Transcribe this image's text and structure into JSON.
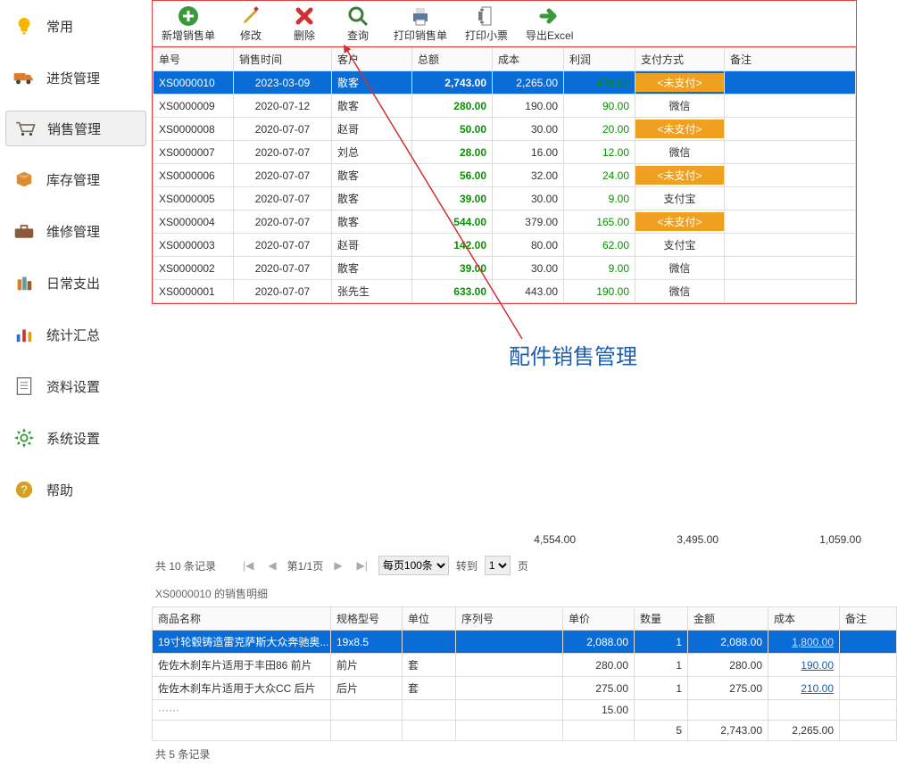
{
  "sidebar": {
    "items": [
      {
        "label": "常用",
        "icon": "bulb",
        "color": "#f7b500"
      },
      {
        "label": "进货管理",
        "icon": "truck",
        "color": "#d97c2b"
      },
      {
        "label": "销售管理",
        "icon": "cart",
        "color": "#7a6a4f",
        "active": true
      },
      {
        "label": "库存管理",
        "icon": "box",
        "color": "#e08b2c"
      },
      {
        "label": "维修管理",
        "icon": "toolbox",
        "color": "#8a5a3a"
      },
      {
        "label": "日常支出",
        "icon": "bottles",
        "color": "#5aa0a0"
      },
      {
        "label": "统计汇总",
        "icon": "chart",
        "color": "#2c6cd6"
      },
      {
        "label": "资料设置",
        "icon": "doc",
        "color": "#6a6a6a"
      },
      {
        "label": "系统设置",
        "icon": "gear",
        "color": "#3a9a3a"
      },
      {
        "label": "帮助",
        "icon": "coin",
        "color": "#d6a020"
      }
    ]
  },
  "toolbar": [
    {
      "label": "新增销售单",
      "icon": "add",
      "color": "#3a9a3a"
    },
    {
      "label": "修改",
      "icon": "edit",
      "color": "#d6a020"
    },
    {
      "label": "删除",
      "icon": "delete",
      "color": "#d03030"
    },
    {
      "label": "查询",
      "icon": "search",
      "color": "#3a7a3a"
    },
    {
      "label": "打印销售单",
      "icon": "printer",
      "color": "#5a7aa0"
    },
    {
      "label": "打印小票",
      "icon": "receipt",
      "color": "#7a7a7a"
    },
    {
      "label": "导出Excel",
      "icon": "export",
      "color": "#3a9a3a"
    }
  ],
  "sales": {
    "headers": [
      "单号",
      "销售时间",
      "客户",
      "总额",
      "成本",
      "利润",
      "支付方式",
      "备注"
    ],
    "rows": [
      {
        "no": "XS0000010",
        "date": "2023-03-09",
        "cust": "散客",
        "total": "2,743.00",
        "cost": "2,265.00",
        "profit": "478.00",
        "pay": "<未支付>",
        "badge": true,
        "selected": true
      },
      {
        "no": "XS0000009",
        "date": "2020-07-12",
        "cust": "散客",
        "total": "280.00",
        "cost": "190.00",
        "profit": "90.00",
        "pay": "微信"
      },
      {
        "no": "XS0000008",
        "date": "2020-07-07",
        "cust": "赵哥",
        "total": "50.00",
        "cost": "30.00",
        "profit": "20.00",
        "pay": "<未支付>",
        "badge": true
      },
      {
        "no": "XS0000007",
        "date": "2020-07-07",
        "cust": "刘总",
        "total": "28.00",
        "cost": "16.00",
        "profit": "12.00",
        "pay": "微信"
      },
      {
        "no": "XS0000006",
        "date": "2020-07-07",
        "cust": "散客",
        "total": "56.00",
        "cost": "32.00",
        "profit": "24.00",
        "pay": "<未支付>",
        "badge": true
      },
      {
        "no": "XS0000005",
        "date": "2020-07-07",
        "cust": "散客",
        "total": "39.00",
        "cost": "30.00",
        "profit": "9.00",
        "pay": "支付宝"
      },
      {
        "no": "XS0000004",
        "date": "2020-07-07",
        "cust": "散客",
        "total": "544.00",
        "cost": "379.00",
        "profit": "165.00",
        "pay": "<未支付>",
        "badge": true
      },
      {
        "no": "XS0000003",
        "date": "2020-07-07",
        "cust": "赵哥",
        "total": "142.00",
        "cost": "80.00",
        "profit": "62.00",
        "pay": "支付宝"
      },
      {
        "no": "XS0000002",
        "date": "2020-07-07",
        "cust": "散客",
        "total": "39.00",
        "cost": "30.00",
        "profit": "9.00",
        "pay": "微信"
      },
      {
        "no": "XS0000001",
        "date": "2020-07-07",
        "cust": "张先生",
        "total": "633.00",
        "cost": "443.00",
        "profit": "190.00",
        "pay": "微信"
      }
    ],
    "totals": {
      "total": "4,554.00",
      "cost": "3,495.00",
      "profit": "1,059.00"
    }
  },
  "annotation": "配件销售管理",
  "pager": {
    "count_text": "共 10 条记录",
    "page_text": "第1/1页",
    "per_page": "每页100条",
    "jump_label": "转到",
    "jump_value": "1",
    "jump_suffix": "页"
  },
  "detail": {
    "title": "XS0000010 的销售明细",
    "headers": [
      "商品名称",
      "规格型号",
      "单位",
      "序列号",
      "单价",
      "数量",
      "金额",
      "成本",
      "备注"
    ],
    "rows": [
      {
        "name": "19寸轮毂铸造雷克萨斯大众奔驰奥...",
        "spec": "19x8.5",
        "unit": "",
        "serial": "",
        "price": "2,088.00",
        "qty": "1",
        "amount": "2,088.00",
        "cost": "1,800.00",
        "selected": true
      },
      {
        "name": "佐佐木刹车片适用于丰田86 前片",
        "spec": "前片",
        "unit": "套",
        "serial": "",
        "price": "280.00",
        "qty": "1",
        "amount": "280.00",
        "cost": "190.00"
      },
      {
        "name": "佐佐木刹车片适用于大众CC 后片",
        "spec": "后片",
        "unit": "套",
        "serial": "",
        "price": "275.00",
        "qty": "1",
        "amount": "275.00",
        "cost": "210.00"
      }
    ],
    "cutoff_row": {
      "price": "15.00",
      "qty": "",
      "amount": "",
      "cost": ""
    },
    "sum": {
      "qty": "5",
      "amount": "2,743.00",
      "cost": "2,265.00"
    },
    "footer": "共 5 条记录"
  }
}
